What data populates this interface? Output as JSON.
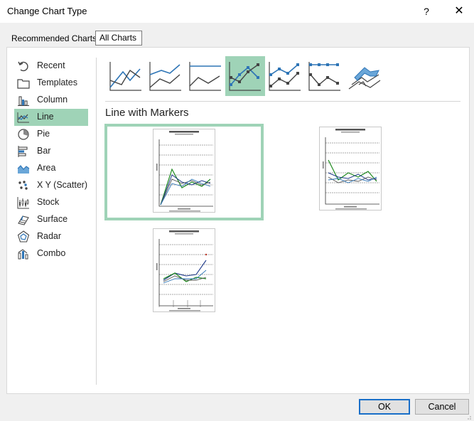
{
  "window": {
    "title": "Change Chart Type",
    "help_label": "?",
    "close_label": "✕"
  },
  "tabs": [
    {
      "label": "Recommended Charts",
      "selected": false
    },
    {
      "label": "All Charts",
      "selected": true
    }
  ],
  "nav": {
    "items": [
      {
        "label": "Recent",
        "icon": "recent-icon"
      },
      {
        "label": "Templates",
        "icon": "folder-icon"
      },
      {
        "label": "Column",
        "icon": "column-chart-icon"
      },
      {
        "label": "Line",
        "icon": "line-chart-icon",
        "selected": true
      },
      {
        "label": "Pie",
        "icon": "pie-chart-icon"
      },
      {
        "label": "Bar",
        "icon": "bar-chart-icon"
      },
      {
        "label": "Area",
        "icon": "area-chart-icon"
      },
      {
        "label": "X Y (Scatter)",
        "icon": "scatter-chart-icon"
      },
      {
        "label": "Stock",
        "icon": "stock-chart-icon"
      },
      {
        "label": "Surface",
        "icon": "surface-chart-icon"
      },
      {
        "label": "Radar",
        "icon": "radar-chart-icon"
      },
      {
        "label": "Combo",
        "icon": "combo-chart-icon"
      }
    ]
  },
  "subtypes": [
    {
      "icon": "line-icon"
    },
    {
      "icon": "stacked-line-icon"
    },
    {
      "icon": "100-stacked-line-icon"
    },
    {
      "icon": "line-with-markers-icon",
      "selected": true
    },
    {
      "icon": "stacked-line-with-markers-icon"
    },
    {
      "icon": "100-stacked-line-with-markers-icon"
    },
    {
      "icon": "3d-line-icon"
    }
  ],
  "section_title": "Line with Markers",
  "footer": {
    "ok_label": "OK",
    "cancel_label": "Cancel"
  },
  "colors": {
    "selection": "#9fd3b7",
    "accent_blue": "#2e75b6",
    "series_green": "#1e8a1e",
    "series_navy": "#1f3a8a",
    "series_gray": "#555555"
  }
}
